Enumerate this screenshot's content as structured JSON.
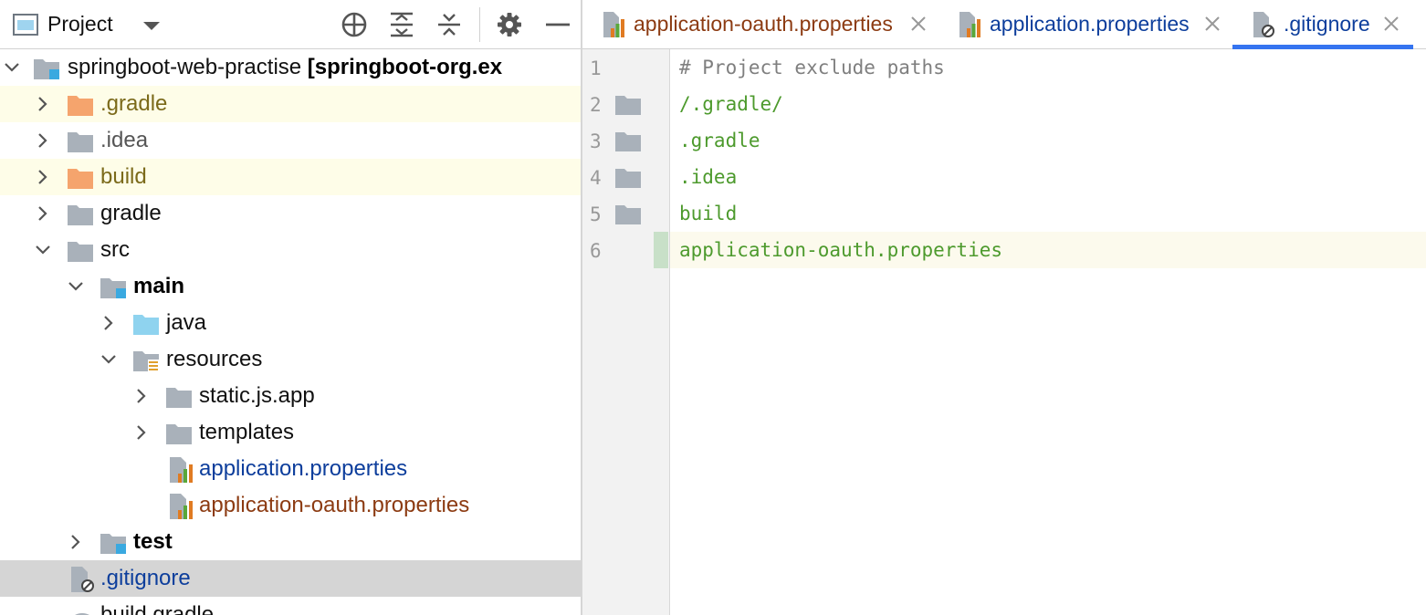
{
  "panel": {
    "title": "Project"
  },
  "tree": {
    "root_label": "springboot-web-practise",
    "root_suffix": "[springboot-org.ex",
    "items": [
      {
        "label": ".gradle"
      },
      {
        "label": ".idea"
      },
      {
        "label": "build"
      },
      {
        "label": "gradle"
      },
      {
        "label": "src"
      },
      {
        "label": "main"
      },
      {
        "label": "java"
      },
      {
        "label": "resources"
      },
      {
        "label": "static.js.app"
      },
      {
        "label": "templates"
      },
      {
        "label": "application.properties"
      },
      {
        "label": "application-oauth.properties"
      },
      {
        "label": "test"
      },
      {
        "label": ".gitignore"
      },
      {
        "label": "build.gradle"
      }
    ]
  },
  "tabs": [
    {
      "label": "application-oauth.properties",
      "color": "#8c3b12"
    },
    {
      "label": "application.properties",
      "color": "#0d3e9c"
    },
    {
      "label": ".gitignore",
      "color": "#0d3e9c",
      "active": true
    }
  ],
  "editor": {
    "lines": [
      {
        "num": "1",
        "text": "# Project exclude paths"
      },
      {
        "num": "2",
        "text": "/.gradle/"
      },
      {
        "num": "3",
        "text": ".gradle"
      },
      {
        "num": "4",
        "text": ".idea"
      },
      {
        "num": "5",
        "text": "build"
      },
      {
        "num": "6",
        "text": "application-oauth.properties"
      }
    ]
  },
  "colors": {
    "accent": "#3574f0",
    "excluded_folder": "#f5a46d",
    "folder": "#a9b1ba",
    "source_folder": "#8fd3ef",
    "highlight_row": "#fefde8",
    "selected_row": "#d5d5d5"
  }
}
